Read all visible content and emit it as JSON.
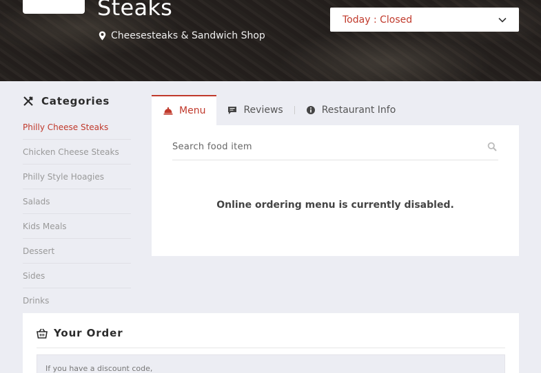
{
  "hero": {
    "restaurant_name": "Steaks",
    "restaurant_type": "Cheesesteaks & Sandwich Shop",
    "hours_selected": "Today : Closed"
  },
  "categories": {
    "title": "Categories",
    "items": [
      {
        "label": "Philly Cheese Steaks",
        "active": true
      },
      {
        "label": "Chicken Cheese Steaks",
        "active": false
      },
      {
        "label": "Philly Style Hoagies",
        "active": false
      },
      {
        "label": "Salads",
        "active": false
      },
      {
        "label": "Kids Meals",
        "active": false
      },
      {
        "label": "Dessert",
        "active": false
      },
      {
        "label": "Sides",
        "active": false
      },
      {
        "label": "Drinks",
        "active": false
      }
    ]
  },
  "tabs": {
    "menu": "Menu",
    "reviews": "Reviews",
    "info": "Restaurant Info"
  },
  "menu": {
    "search_placeholder": "Search food item",
    "message": "Online ordering menu is currently disabled."
  },
  "order": {
    "title": "Your Order",
    "discount_text": "If you have a discount code,"
  },
  "colors": {
    "accent": "#c0392b",
    "background": "#ecedf3"
  }
}
